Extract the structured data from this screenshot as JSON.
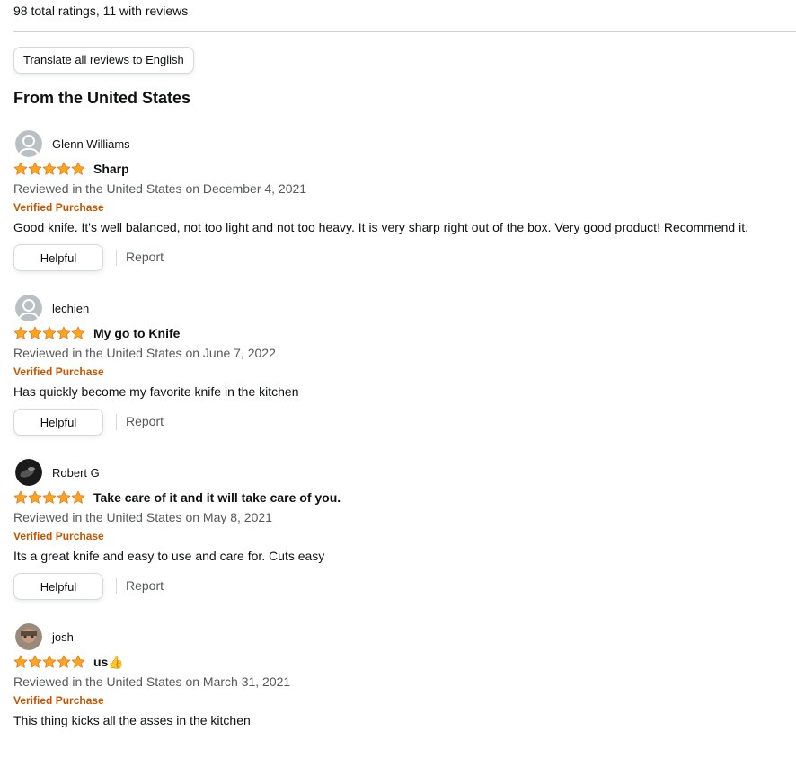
{
  "summary": "98 total ratings, 11 with reviews",
  "translate_label": "Translate all reviews to English",
  "section_title": "From the United States",
  "colors": {
    "star": "#FFA41C",
    "verified": "#C45500",
    "link": "#565959"
  },
  "reviews": [
    {
      "name": "Glenn Williams",
      "avatar": "default-avatar",
      "rating": 5,
      "title": "Sharp",
      "date": "Reviewed in the United States on December 4, 2021",
      "verified": "Verified Purchase",
      "body": "Good knife. It's well balanced, not too light and not too heavy. It is very sharp right out of the box. Very good product! Recommend it.",
      "helpful": "Helpful",
      "report": "Report"
    },
    {
      "name": "lechien",
      "avatar": "default-avatar",
      "rating": 5,
      "title": "My go to Knife",
      "date": "Reviewed in the United States on June 7, 2022",
      "verified": "Verified Purchase",
      "body": "Has quickly become my favorite knife in the kitchen",
      "helpful": "Helpful",
      "report": "Report"
    },
    {
      "name": "Robert G",
      "avatar": "dark-photo-avatar",
      "rating": 5,
      "title": "Take care of it and it will take care of you.",
      "date": "Reviewed in the United States on May 8, 2021",
      "verified": "Verified Purchase",
      "body": "Its a great knife and easy to use and care for. Cuts easy",
      "helpful": "Helpful",
      "report": "Report"
    },
    {
      "name": "josh",
      "avatar": "photo-avatar",
      "rating": 5,
      "title": "us👍",
      "date": "Reviewed in the United States on March 31, 2021",
      "verified": "Verified Purchase",
      "body": "This thing kicks all the asses in the kitchen",
      "helpful": "Helpful",
      "report": "Report"
    }
  ]
}
